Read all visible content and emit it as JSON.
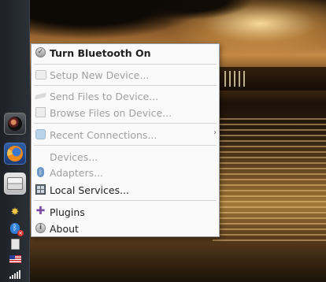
{
  "menu": {
    "items": [
      {
        "label": "Turn Bluetooth On",
        "icon": "power-toggle-icon",
        "enabled": true,
        "bold": true
      },
      {
        "label": "Setup New Device...",
        "icon": "device-setup-icon",
        "enabled": false
      },
      {
        "label": "Send Files to Device...",
        "icon": "send-files-icon",
        "enabled": false
      },
      {
        "label": "Browse Files on Device...",
        "icon": "browse-files-icon",
        "enabled": false
      },
      {
        "label": "Recent Connections...",
        "icon": "recent-connections-icon",
        "enabled": false,
        "submenu": true
      },
      {
        "label": "Devices...",
        "icon": "",
        "enabled": false
      },
      {
        "label": "Adapters...",
        "icon": "bluetooth-icon",
        "enabled": false
      },
      {
        "label": "Local Services...",
        "icon": "local-services-icon",
        "enabled": true
      },
      {
        "label": "Plugins",
        "icon": "puzzle-piece-icon",
        "enabled": true
      },
      {
        "label": "About",
        "icon": "info-icon",
        "enabled": true
      }
    ],
    "submenu_glyph": "›"
  },
  "panel": {
    "launchers": [
      "camera-app-icon",
      "firefox-icon",
      "file-manager-icon"
    ],
    "tray": [
      "updates-icon",
      "bluetooth-disabled-icon",
      "clipboard-icon",
      "us-flag-keyboard-icon",
      "network-signal-icon"
    ]
  },
  "colors": {
    "menu_bg": "#fafafa",
    "menu_border": "#9aa0a6",
    "text_enabled": "#222222",
    "text_disabled": "#a0a0a0",
    "panel_bg": "#2b3038"
  }
}
